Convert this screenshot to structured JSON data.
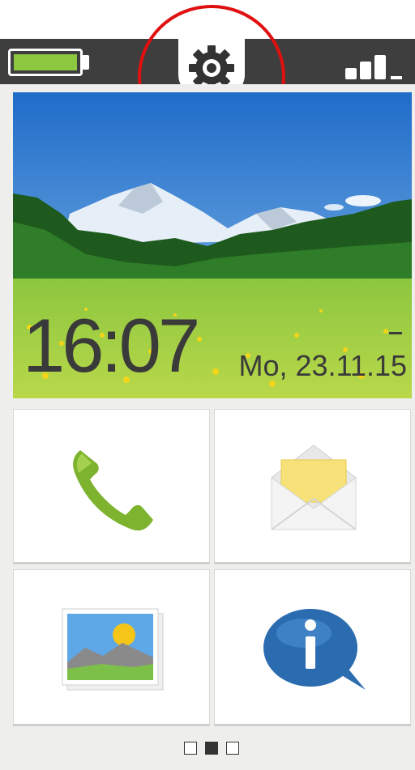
{
  "status_bar": {
    "battery_level": 1.0,
    "icons": [
      "battery-icon",
      "gear-icon",
      "signal-icon"
    ],
    "colors": {
      "bar": "#3e3e3e",
      "battery_fill": "#8dc63f"
    }
  },
  "home": {
    "time": "16:07",
    "date": "Mo, 23.11.15",
    "date_dash": "–"
  },
  "tiles": [
    {
      "id": "phone",
      "icon": "phone-handset-icon"
    },
    {
      "id": "messages",
      "icon": "envelope-icon"
    },
    {
      "id": "gallery",
      "icon": "photo-gallery-icon"
    },
    {
      "id": "info",
      "icon": "info-bubble-icon"
    }
  ],
  "pager": {
    "pages": 3,
    "current": 2
  }
}
